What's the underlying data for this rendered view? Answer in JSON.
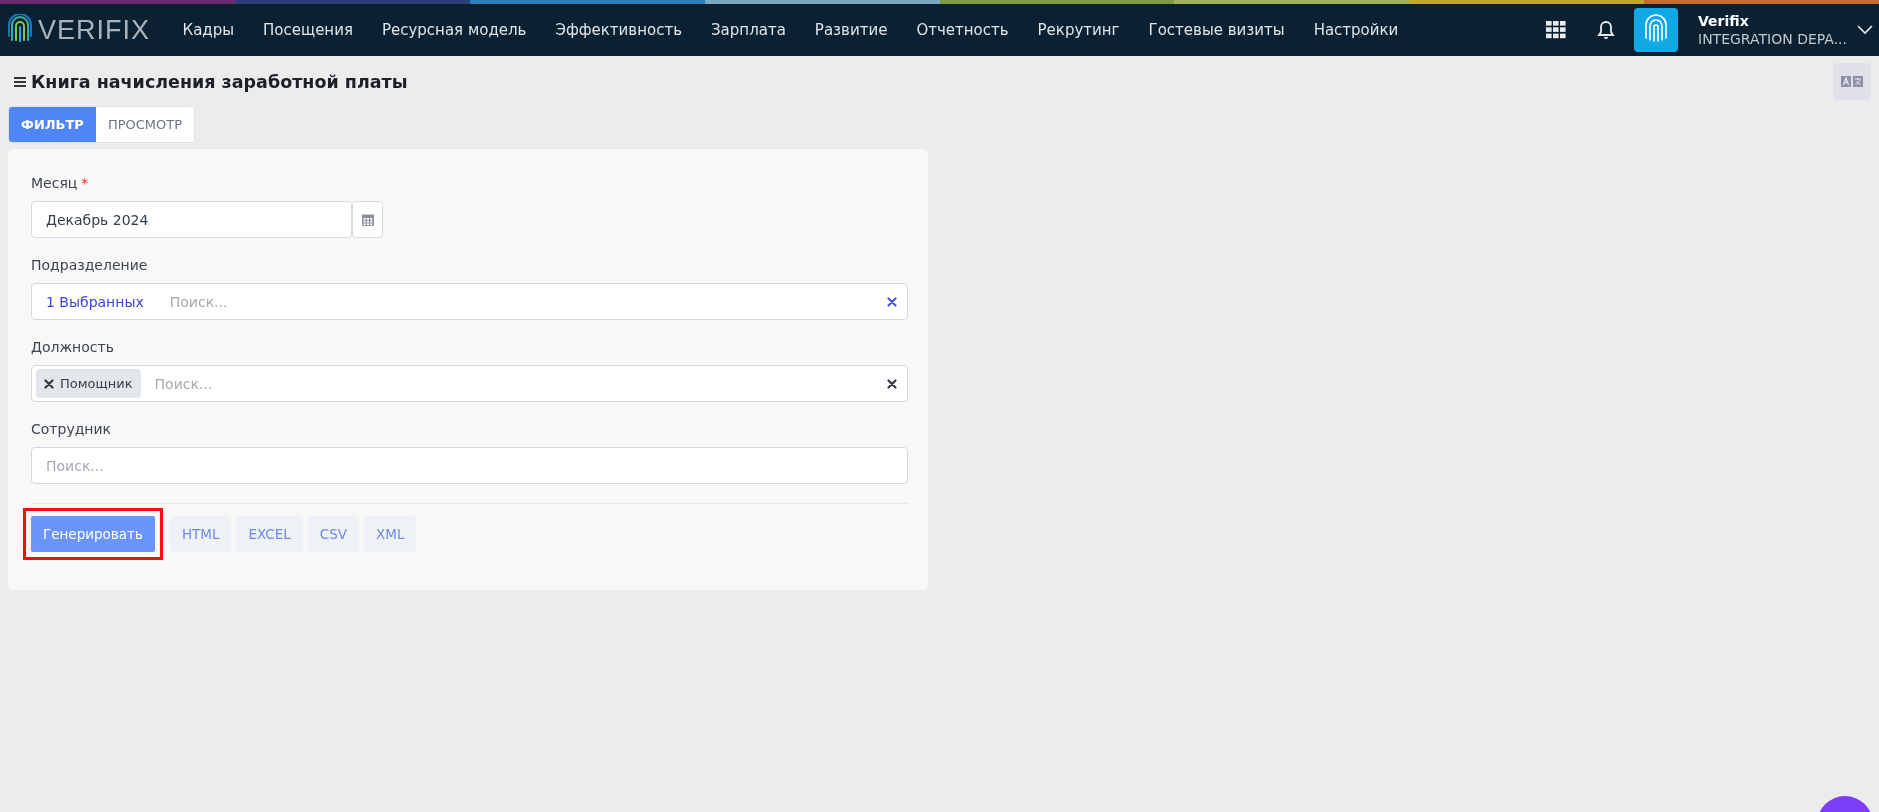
{
  "header": {
    "logo_text": "VERIFIX",
    "nav": [
      "Кадры",
      "Посещения",
      "Ресурсная модель",
      "Эффективность",
      "Зарплата",
      "Развитие",
      "Отчетность",
      "Рекрутинг",
      "Гостевые визиты",
      "Настройки"
    ],
    "user": {
      "name": "Verifix",
      "org": "INTEGRATION DEPA..."
    }
  },
  "page": {
    "title": "Книга начисления заработной платы",
    "tabs": [
      {
        "label": "ФИЛЬТР",
        "selected": true
      },
      {
        "label": "ПРОСМОТР",
        "selected": false
      }
    ]
  },
  "form": {
    "fields": [
      {
        "kind": "date",
        "label": "Месяц",
        "required_mark": "*",
        "value": "Декабрь 2024"
      },
      {
        "kind": "multi",
        "label": "Подразделение",
        "summary": "1 Выбранных",
        "placeholder": "Поиск..."
      },
      {
        "kind": "tags",
        "label": "Должность",
        "tags": [
          "Помощник"
        ],
        "placeholder": "Поиск..."
      },
      {
        "kind": "search",
        "label": "Сотрудник",
        "placeholder": "Поиск..."
      }
    ],
    "actions": [
      {
        "label": "Генерировать",
        "kind": "primary",
        "highlighted": true
      },
      {
        "label": "HTML",
        "kind": "format",
        "highlighted": false
      },
      {
        "label": "EXCEL",
        "kind": "format",
        "highlighted": false
      },
      {
        "label": "CSV",
        "kind": "format",
        "highlighted": false
      },
      {
        "label": "XML",
        "kind": "format",
        "highlighted": false
      }
    ]
  }
}
